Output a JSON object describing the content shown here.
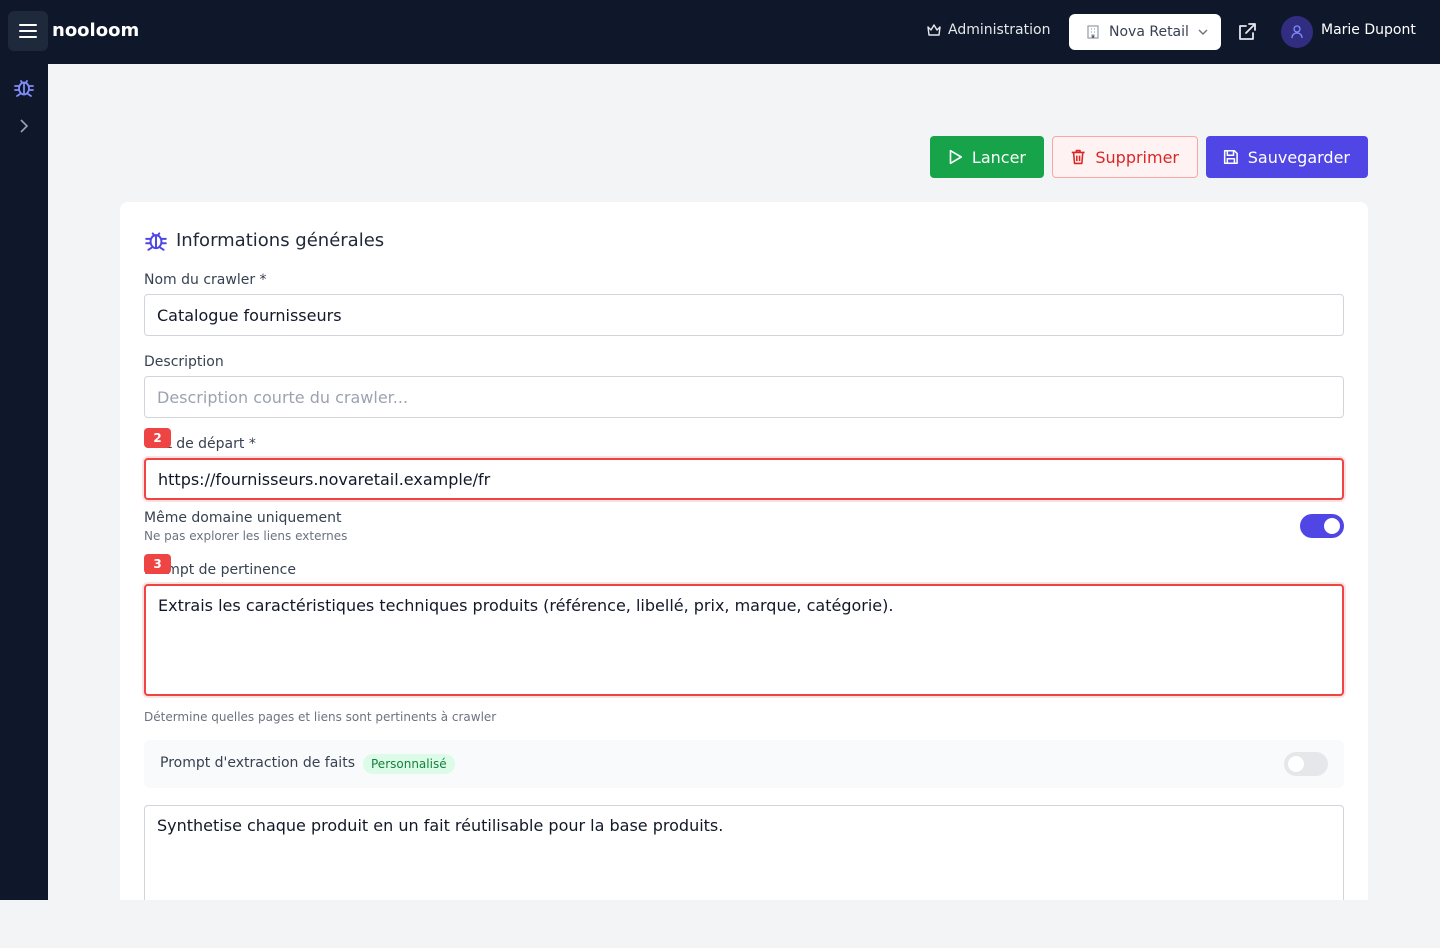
{
  "header": {
    "brand": "nooloom",
    "admin_label": "Administration",
    "org_name": "Nova Retail",
    "user_name": "Marie Dupont"
  },
  "actions": {
    "run_label": "Lancer",
    "delete_label": "Supprimer",
    "save_label": "Sauvegarder"
  },
  "form": {
    "section_title": "Informations générales",
    "name_label": "Nom du crawler *",
    "name_value": "Catalogue fournisseurs",
    "description_label": "Description",
    "description_placeholder": "Description courte du crawler...",
    "start_url_label": "URL de départ *",
    "start_url_value": "https://fournisseurs.novaretail.example/fr",
    "same_domain_label": "Même domaine uniquement",
    "same_domain_hint": "Ne pas explorer les liens externes",
    "same_domain_enabled": true,
    "relevance_label": "Prompt de pertinence",
    "relevance_value": "Extrais les caractéristiques techniques produits (référence, libellé, prix, marque, catégorie).",
    "relevance_hint": "Détermine quelles pages et liens sont pertinents à crawler",
    "extraction_label": "Prompt d'extraction de faits",
    "extraction_badge": "Personnalisé",
    "extraction_enabled": false,
    "extraction_value": "Synthetise chaque produit en un fait réutilisable pour la base produits."
  },
  "annotations": {
    "badge_url": "2",
    "badge_prompt": "3"
  },
  "colors": {
    "nav_bg": "#0f172a",
    "primary": "#4f46e5",
    "success": "#16a34a",
    "danger": "#dc2626",
    "highlight": "#ef4444"
  }
}
